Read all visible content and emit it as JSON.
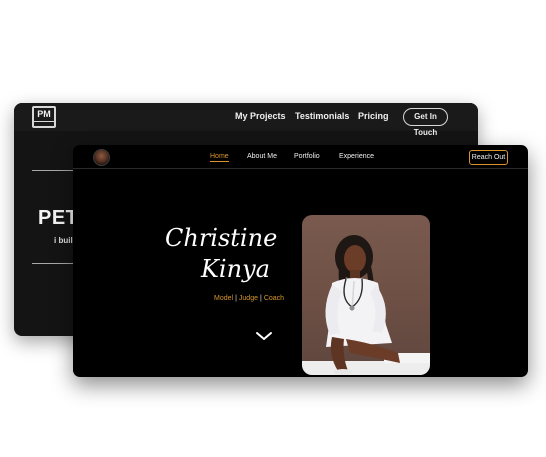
{
  "back_site": {
    "logo_text": "PM",
    "nav": [
      "My Projects",
      "Testimonials",
      "Pricing"
    ],
    "cta": "Get In Touch",
    "hero_name": "PETE",
    "hero_tagline": "i build"
  },
  "front_site": {
    "nav": [
      {
        "label": "Home",
        "active": true
      },
      {
        "label": "About Me",
        "active": false
      },
      {
        "label": "Portfolio",
        "active": false
      },
      {
        "label": "Experience",
        "active": false
      }
    ],
    "cta": "Reach Out",
    "hero": {
      "first_name": "Christine",
      "last_name": "Kinya",
      "roles": [
        "Model",
        "Judge",
        "Coach"
      ],
      "separator": "|"
    },
    "colors": {
      "accent": "#d9952c",
      "background": "#000000"
    },
    "icons": {
      "scroll": "chevron-down-icon",
      "avatar": "avatar"
    }
  }
}
